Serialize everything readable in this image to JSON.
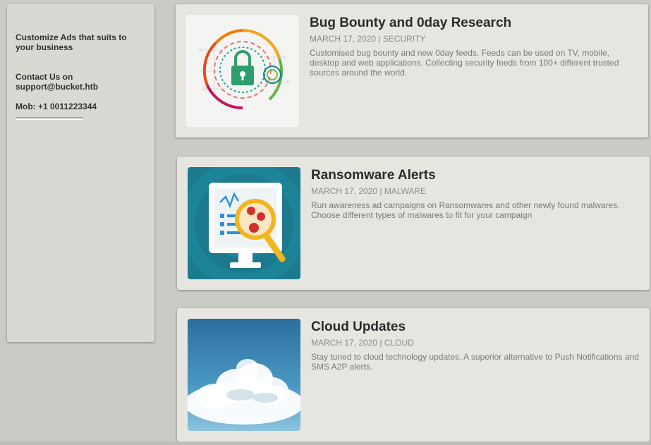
{
  "sidebar": {
    "tagline": "Customize Ads that suits to your business",
    "contact_label": "Contact Us on",
    "contact_email": "support@bucket.htb",
    "mobile": "Mob: +1 0011223344"
  },
  "posts": [
    {
      "title": "Bug Bounty and 0day Research",
      "meta": "MARCH 17, 2020 | SECURITY",
      "description": "Customised bug bounty and new 0day feeds. Feeds can be used on TV, mobile, desktop and web applications. Collecting security feeds from 100+ different trusted sources around the world.",
      "image_icon": "padlock-circuit-icon"
    },
    {
      "title": "Ransomware Alerts",
      "meta": "MARCH 17, 2020 | MALWARE",
      "description": "Run awareness ad campaigns on Ransomwares and other newly found malwares. Choose different types of malwares to fit for your campaign",
      "image_icon": "monitor-magnifier-malware-icon"
    },
    {
      "title": "Cloud Updates",
      "meta": "MARCH 17, 2020 | CLOUD",
      "description": "Stay tuned to cloud technology updates. A superior alternative to Push Notifications and SMS A2P alerts.",
      "image_icon": "cloud-sky-icon"
    }
  ],
  "colors": {
    "background": "#cbcbc5",
    "card": "#e6e5e0",
    "sidebar": "#d9d8d2",
    "title_text": "#2b2b2b",
    "meta_text": "#8c8c8c",
    "ransomware_bg": "#1b7a8e",
    "sky_blue": "#3c88b8"
  }
}
